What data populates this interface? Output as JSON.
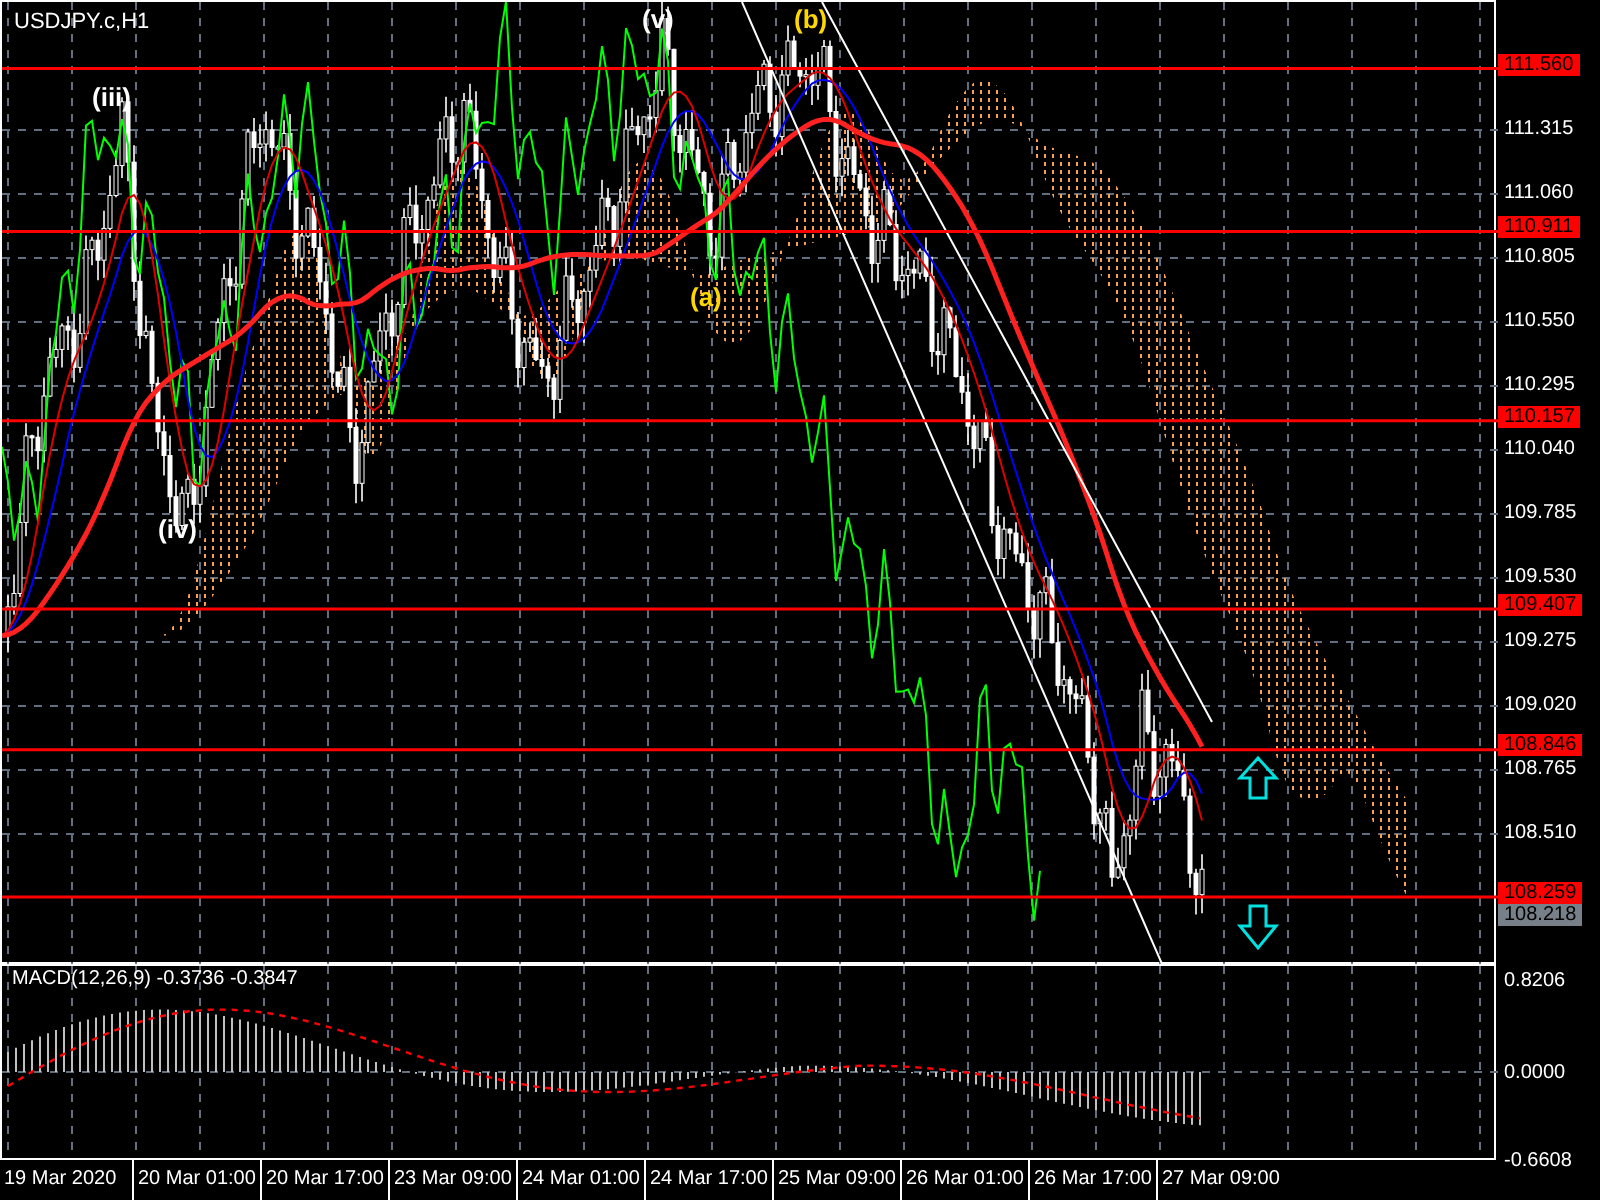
{
  "chart_title": "USDJPY.c,H1",
  "price_axis": {
    "ticks": [
      "111.315",
      "111.060",
      "110.805",
      "110.550",
      "110.295",
      "110.040",
      "109.785",
      "109.530",
      "109.275",
      "109.020",
      "108.765",
      "108.510"
    ]
  },
  "levels": [
    {
      "price": "111.560"
    },
    {
      "price": "110.911"
    },
    {
      "price": "110.157"
    },
    {
      "price": "109.407"
    },
    {
      "price": "108.846"
    },
    {
      "price": "108.259"
    }
  ],
  "current_price": "108.218",
  "wave_labels": [
    {
      "text": "(iii)",
      "color": "#ffffff"
    },
    {
      "text": "(iv)",
      "color": "#ffffff"
    },
    {
      "text": "(v)",
      "color": "#ffffff"
    },
    {
      "text": "(b)",
      "color": "#ffd700"
    },
    {
      "text": "(a)",
      "color": "#ffd700"
    }
  ],
  "macd": {
    "label": "MACD(12,26,9) -0.3736 -0.3847",
    "ticks": [
      "0.8206",
      "0.0000",
      "-0.6608"
    ]
  },
  "time_axis": [
    "19 Mar 2020",
    "20 Mar 01:00",
    "20 Mar 17:00",
    "23 Mar 09:00",
    "24 Mar 01:00",
    "24 Mar 17:00",
    "25 Mar 09:00",
    "26 Mar 01:00",
    "26 Mar 17:00",
    "27 Mar 09:00"
  ]
}
